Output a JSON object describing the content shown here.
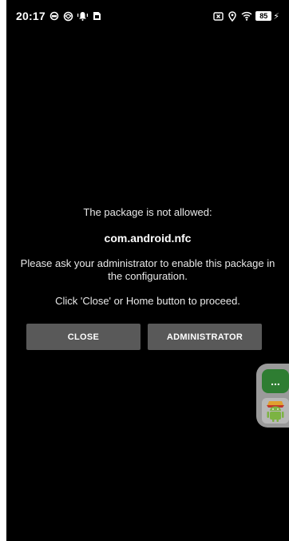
{
  "status_bar": {
    "time": "20:17",
    "battery_level": "85",
    "icons_left": [
      "ring-icon",
      "vpn-icon",
      "notification-icon",
      "sim-icon"
    ],
    "icons_right": [
      "vibrate-icon",
      "location-icon",
      "wifi-icon",
      "battery-icon",
      "charging-icon"
    ]
  },
  "dialog": {
    "message_header": "The package is not allowed:",
    "package_name": "com.android.nfc",
    "message_body": "Please ask your administrator to enable this package in the configuration.",
    "message_proceed": "Click 'Close' or Home button to proceed.",
    "close_label": "CLOSE",
    "admin_label": "ADMINISTRATOR"
  },
  "floating_bubble": {
    "more_label": "...",
    "app_icon": "android-icon"
  },
  "colors": {
    "background": "#000000",
    "button": "#595959",
    "bubble": "#9a9a9a",
    "bubble_accent": "#2e7d32"
  }
}
